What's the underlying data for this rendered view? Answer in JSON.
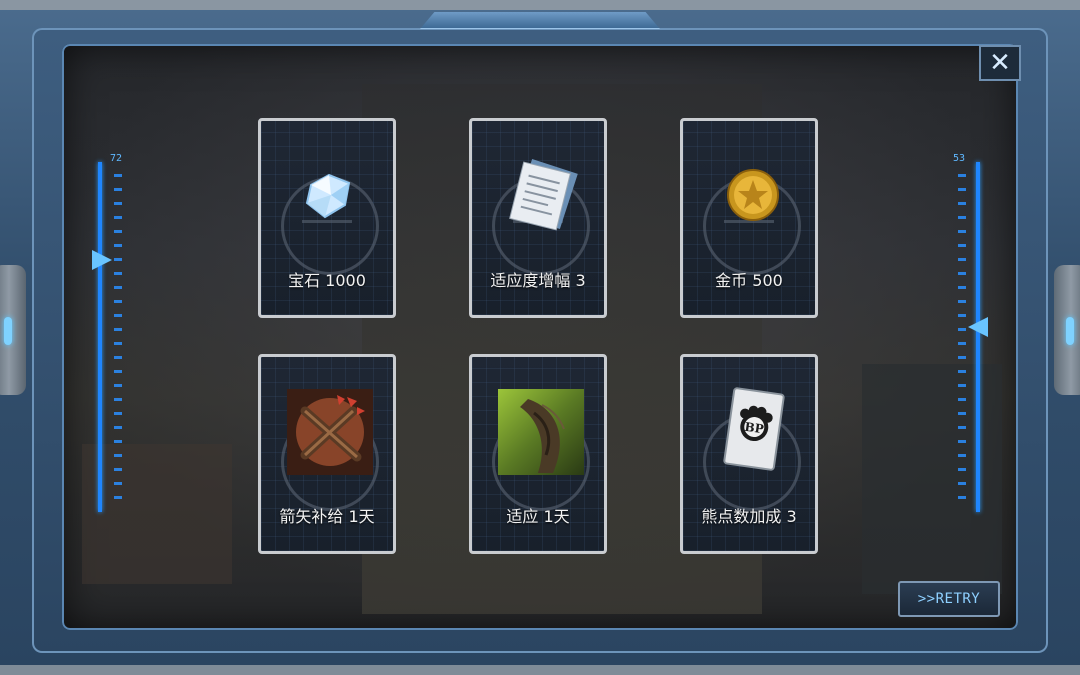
{
  "gauges": {
    "left_value": "72",
    "right_value": "53"
  },
  "close_icon": "close-icon",
  "rewards": [
    {
      "label": "宝石 1000",
      "icon": "gem-icon"
    },
    {
      "label": "适应度增幅 3",
      "icon": "documents-icon"
    },
    {
      "label": "金币 500",
      "icon": "gold-coin-icon"
    },
    {
      "label": "箭矢补给 1天",
      "icon": "arrows-bundle-icon"
    },
    {
      "label": "适应 1天",
      "icon": "adaptation-icon"
    },
    {
      "label": "熊点数加成 3",
      "icon": "bp-card-icon"
    }
  ],
  "retry_label": ">>RETRY",
  "colors": {
    "accent_blue": "#1f86ff",
    "card_border": "#c9ccd0",
    "retry_text": "#8ed0ff"
  }
}
